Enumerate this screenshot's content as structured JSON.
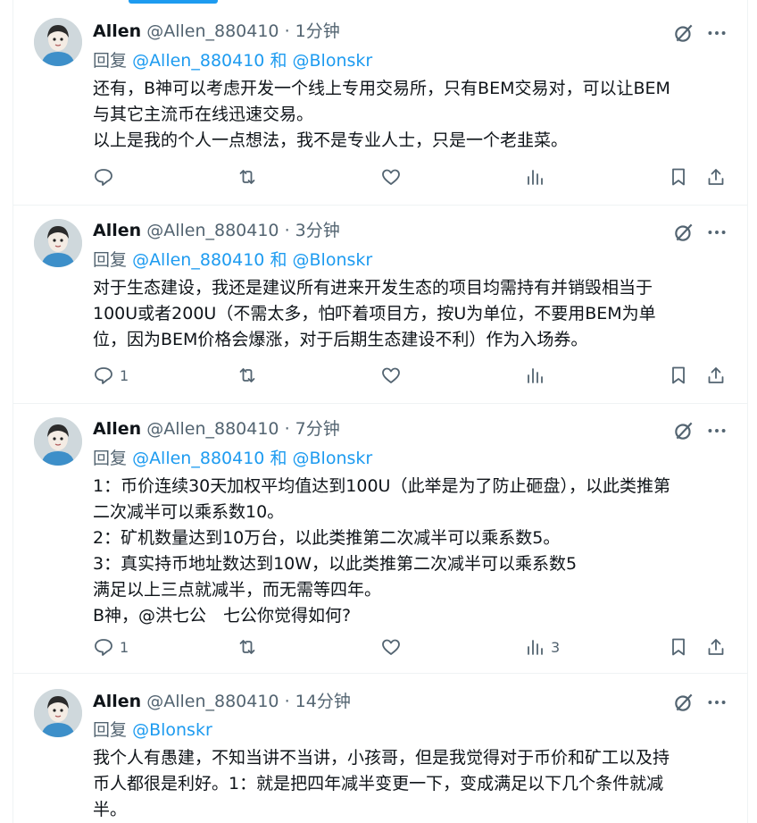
{
  "tweets": [
    {
      "name": "Allen",
      "handle": "@Allen_880410",
      "separator": "·",
      "time": "1分钟",
      "reply_prefix": "回复",
      "reply_to_1": "@Allen_880410",
      "reply_and": "和",
      "reply_to_2": "@Blonskr",
      "lines": [
        "还有，B神可以考虑开发一个线上专用交易所，只有BEM交易对，可以让BEM",
        "与其它主流币在线迅速交易。",
        "以上是我的个人一点想法，我不是专业人士，只是一个老韭菜。"
      ],
      "reply_count": "",
      "view_count": ""
    },
    {
      "name": "Allen",
      "handle": "@Allen_880410",
      "separator": "·",
      "time": "3分钟",
      "reply_prefix": "回复",
      "reply_to_1": "@Allen_880410",
      "reply_and": "和",
      "reply_to_2": "@Blonskr",
      "lines": [
        "对于生态建设，我还是建议所有进来开发生态的项目均需持有并销毁相当于",
        "100U或者200U（不需太多，怕吓着项目方，按U为单位，不要用BEM为单",
        "位，因为BEM价格会爆涨，对于后期生态建设不利）作为入场券。"
      ],
      "reply_count": "1",
      "view_count": ""
    },
    {
      "name": "Allen",
      "handle": "@Allen_880410",
      "separator": "·",
      "time": "7分钟",
      "reply_prefix": "回复",
      "reply_to_1": "@Allen_880410",
      "reply_and": "和",
      "reply_to_2": "@Blonskr",
      "lines": [
        "1：币价连续30天加权平均值达到100U（此举是为了防止砸盘），以此类推第",
        "二次减半可以乘系数10。",
        "2：矿机数量达到10万台，以此类推第二次减半可以乘系数5。",
        "3：真实持币地址数达到10W，以此类推第二次减半可以乘系数5",
        "满足以上三点就减半，而无需等四年。",
        "B神，@洪七公　七公你觉得如何?"
      ],
      "reply_count": "1",
      "view_count": "3"
    },
    {
      "name": "Allen",
      "handle": "@Allen_880410",
      "separator": "·",
      "time": "14分钟",
      "reply_prefix": "回复",
      "reply_to_1": "@Blonskr",
      "reply_and": "",
      "reply_to_2": "",
      "lines": [
        "我个人有愚建，不知当讲不当讲，小孩哥，但是我觉得对于币价和矿工以及持",
        "币人都很是利好。1：就是把四年减半变更一下，变成满足以下几个条件就减",
        "半。"
      ],
      "reply_count": "",
      "view_count": ""
    }
  ],
  "icons": {
    "grok": "grok-icon",
    "more": "more-icon",
    "reply": "reply-icon",
    "retweet": "retweet-icon",
    "like": "like-icon",
    "views": "views-icon",
    "bookmark": "bookmark-icon",
    "share": "share-icon"
  },
  "colors": {
    "link": "#1d9bf0",
    "secondary_text": "#536471",
    "primary_text": "#0f1419",
    "divider": "#eff3f4"
  }
}
